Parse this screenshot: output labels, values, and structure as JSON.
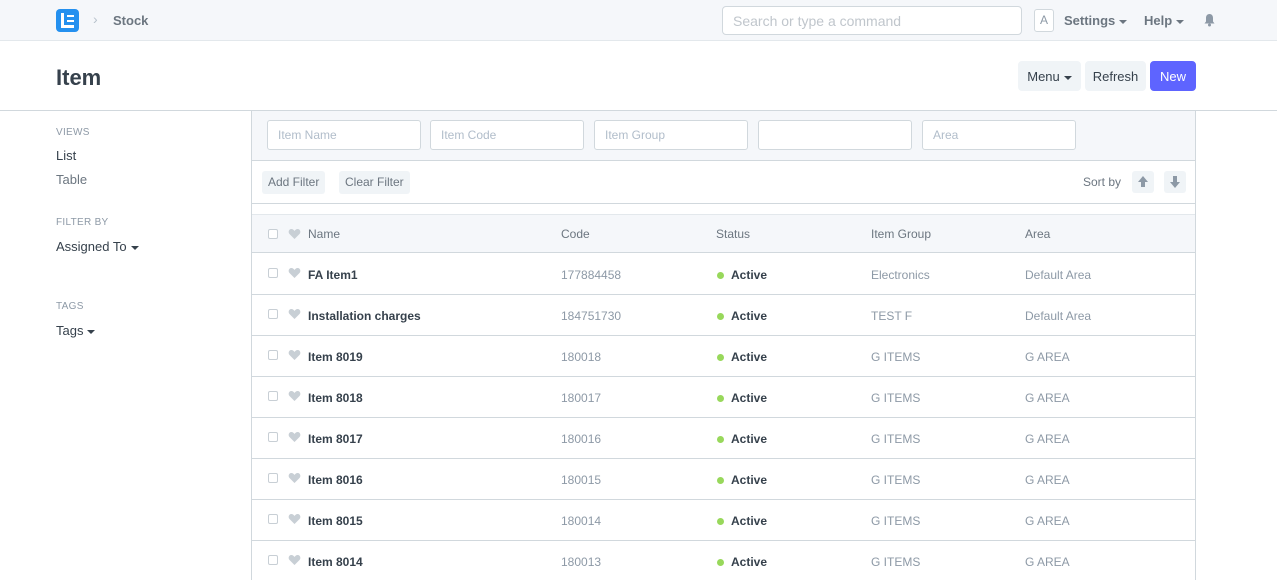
{
  "navbar": {
    "breadcrumb": "Stock",
    "search_placeholder": "Search or type a command",
    "avatar_letter": "A",
    "settings": "Settings",
    "help": "Help"
  },
  "page": {
    "title": "Item",
    "menu_label": "Menu",
    "refresh_label": "Refresh",
    "new_label": "New",
    "primary_color": "#5e64ff"
  },
  "sidebar": {
    "views_heading": "VIEWS",
    "views": [
      "List",
      "Table"
    ],
    "filter_heading": "FILTER BY",
    "assigned_to": "Assigned To",
    "tags_heading": "TAGS",
    "tags": "Tags"
  },
  "filters": {
    "item_name": "Item Name",
    "item_code": "Item Code",
    "item_group": "Item Group",
    "blank": "",
    "area": "Area",
    "add_filter": "Add Filter",
    "clear_filter": "Clear Filter",
    "sort_by": "Sort by"
  },
  "columns": [
    "Name",
    "Code",
    "Status",
    "Item Group",
    "Area"
  ],
  "rows": [
    {
      "name": "FA Item1",
      "code": "177884458",
      "status": "Active",
      "group": "Electronics",
      "area": "Default Area"
    },
    {
      "name": "Installation charges",
      "code": "184751730",
      "status": "Active",
      "group": "TEST F",
      "area": "Default Area"
    },
    {
      "name": "Item 8019",
      "code": "180018",
      "status": "Active",
      "group": "G ITEMS",
      "area": "G AREA"
    },
    {
      "name": "Item 8018",
      "code": "180017",
      "status": "Active",
      "group": "G ITEMS",
      "area": "G AREA"
    },
    {
      "name": "Item 8017",
      "code": "180016",
      "status": "Active",
      "group": "G ITEMS",
      "area": "G AREA"
    },
    {
      "name": "Item 8016",
      "code": "180015",
      "status": "Active",
      "group": "G ITEMS",
      "area": "G AREA"
    },
    {
      "name": "Item 8015",
      "code": "180014",
      "status": "Active",
      "group": "G ITEMS",
      "area": "G AREA"
    },
    {
      "name": "Item 8014",
      "code": "180013",
      "status": "Active",
      "group": "G ITEMS",
      "area": "G AREA"
    }
  ]
}
